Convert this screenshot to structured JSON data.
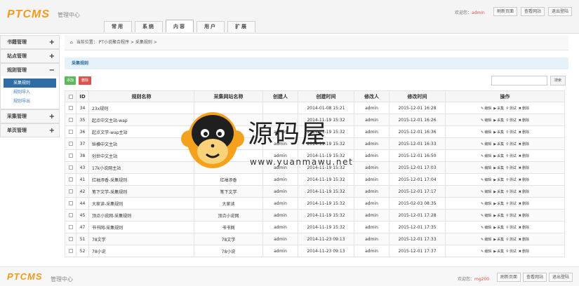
{
  "header": {
    "logo": "PTCMS",
    "subtitle": "管理中心",
    "welcome_label": "欢迎您：",
    "username": "admin",
    "buttons": [
      "刷新页面",
      "查看网站",
      "退出登陆"
    ]
  },
  "tabs": [
    {
      "label": "常用",
      "active": false
    },
    {
      "label": "系统",
      "active": false
    },
    {
      "label": "内容",
      "active": true
    },
    {
      "label": "用户",
      "active": false
    },
    {
      "label": "扩展",
      "active": false
    }
  ],
  "sidebar": {
    "groups": [
      {
        "title": "书籍管理",
        "expander": "+",
        "items": []
      },
      {
        "title": "站点管理",
        "expander": "+",
        "items": []
      },
      {
        "title": "规则管理",
        "expander": "−",
        "items": [
          {
            "label": "采集规则",
            "active": true
          },
          {
            "label": "规则导入",
            "active": false
          },
          {
            "label": "规则导出",
            "active": false
          }
        ]
      },
      {
        "title": "采集管理",
        "expander": "+",
        "items": []
      },
      {
        "title": "单页管理",
        "expander": "+",
        "items": []
      }
    ]
  },
  "breadcrumb": {
    "prefix": "当前位置：",
    "parts": [
      "PT小说聚合程序",
      ">",
      "采集规则",
      ">"
    ]
  },
  "section_title": "采集规则",
  "toolbar": {
    "add_label": "添加",
    "delete_label": "删除",
    "search_placeholder": "",
    "search_label": "搜索"
  },
  "table": {
    "headers": [
      "",
      "ID",
      "规则名称",
      "采集网站名称",
      "创建人",
      "创建时间",
      "修改人",
      "修改时间",
      "操作"
    ],
    "ops": [
      "编辑",
      "采集",
      "测试",
      "删除"
    ],
    "rows": [
      {
        "id": "34",
        "name": "23x规则",
        "site": "",
        "creator": "",
        "created": "2014-01-08 15:21",
        "modifier": "admin",
        "modified": "2015-12-01 16:28"
      },
      {
        "id": "35",
        "name": "起点中文主站-wap",
        "site": "",
        "creator": "",
        "created": "2014-11-19 15:32",
        "modifier": "admin",
        "modified": "2015-12-01 16:26"
      },
      {
        "id": "36",
        "name": "起点文学-wap主站",
        "site": "",
        "creator": "admin",
        "created": "2014-11-19 15:32",
        "modifier": "admin",
        "modified": "2015-12-01 16:36"
      },
      {
        "id": "37",
        "name": "纵横中文主站",
        "site": "",
        "creator": "admin",
        "created": "2014-11-19 15:32",
        "modifier": "admin",
        "modified": "2015-12-01 16:33"
      },
      {
        "id": "38",
        "name": "创世中文主站",
        "site": "",
        "creator": "admin",
        "created": "2014-11-19 15:32",
        "modifier": "admin",
        "modified": "2015-12-01 16:50"
      },
      {
        "id": "43",
        "name": "17k小说网主站",
        "site": "",
        "creator": "admin",
        "created": "2014-11-19 15:32",
        "modifier": "admin",
        "modified": "2015-12-01 17:03"
      },
      {
        "id": "41",
        "name": "红袖添香-采集规则",
        "site": "红袖添香",
        "creator": "admin",
        "created": "2014-11-19 15:32",
        "modifier": "admin",
        "modified": "2015-12-01 17:04"
      },
      {
        "id": "42",
        "name": "笔下文学-采集规则",
        "site": "笔下文学",
        "creator": "admin",
        "created": "2014-11-19 15:32",
        "modifier": "admin",
        "modified": "2015-12-01 17:17"
      },
      {
        "id": "44",
        "name": "大家读-采集规则",
        "site": "大家读",
        "creator": "admin",
        "created": "2014-11-19 15:32",
        "modifier": "admin",
        "modified": "2015-02-03 08:35"
      },
      {
        "id": "45",
        "name": "顶点小说网-采集规则",
        "site": "顶点小说网",
        "creator": "admin",
        "created": "2014-11-19 15:32",
        "modifier": "admin",
        "modified": "2015-12-01 17:28"
      },
      {
        "id": "47",
        "name": "书书网-采集规则",
        "site": "书书网",
        "creator": "admin",
        "created": "2014-11-19 15:32",
        "modifier": "admin",
        "modified": "2015-12-01 17:35"
      },
      {
        "id": "51",
        "name": "78文学",
        "site": "78文学",
        "creator": "admin",
        "created": "2014-11-23 09:13",
        "modifier": "admin",
        "modified": "2015-12-01 17:33"
      },
      {
        "id": "52",
        "name": "78小说",
        "site": "78小说",
        "creator": "admin",
        "created": "2014-11-23 09:13",
        "modifier": "admin",
        "modified": "2015-12-01 17:37"
      }
    ]
  },
  "watermark": {
    "text": "源码屋",
    "url": "www.yuanmawu.net"
  },
  "footer": {
    "logo": "PTCMS",
    "subtitle": "管理中心",
    "welcome_label": "欢迎您：",
    "username": "mg200",
    "buttons": [
      "刷新页面",
      "查看网站",
      "退出登陆"
    ]
  },
  "colors": {
    "logo": "#f39a1e",
    "add_button": "#5cb85c",
    "delete_button": "#d9534f",
    "sidebar_active": "#2d6da3",
    "section_bg": "#e7f1f9"
  }
}
